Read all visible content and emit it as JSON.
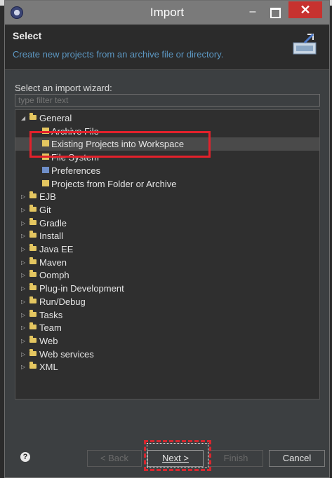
{
  "window": {
    "title": "Import",
    "controls": {
      "minimize": "–",
      "maximize": "",
      "close": "✕"
    }
  },
  "header": {
    "title": "Select",
    "description": "Create new projects from an archive file or directory."
  },
  "wizard": {
    "label": "Select an import wizard:",
    "filter_placeholder": "type filter text",
    "tree": [
      {
        "label": "General",
        "expanded": true,
        "children": [
          {
            "label": "Archive File"
          },
          {
            "label": "Existing Projects into Workspace",
            "selected": true
          },
          {
            "label": "File System"
          },
          {
            "label": "Preferences"
          },
          {
            "label": "Projects from Folder or Archive"
          }
        ]
      },
      {
        "label": "EJB"
      },
      {
        "label": "Git"
      },
      {
        "label": "Gradle"
      },
      {
        "label": "Install"
      },
      {
        "label": "Java EE"
      },
      {
        "label": "Maven"
      },
      {
        "label": "Oomph"
      },
      {
        "label": "Plug-in Development"
      },
      {
        "label": "Run/Debug"
      },
      {
        "label": "Tasks"
      },
      {
        "label": "Team"
      },
      {
        "label": "Web"
      },
      {
        "label": "Web services"
      },
      {
        "label": "XML"
      }
    ]
  },
  "footer": {
    "help": "?",
    "back": "< Back",
    "next": "Next >",
    "finish": "Finish",
    "cancel": "Cancel"
  },
  "colors": {
    "highlight": "#e3212b",
    "link_blue": "#5c97c2"
  }
}
